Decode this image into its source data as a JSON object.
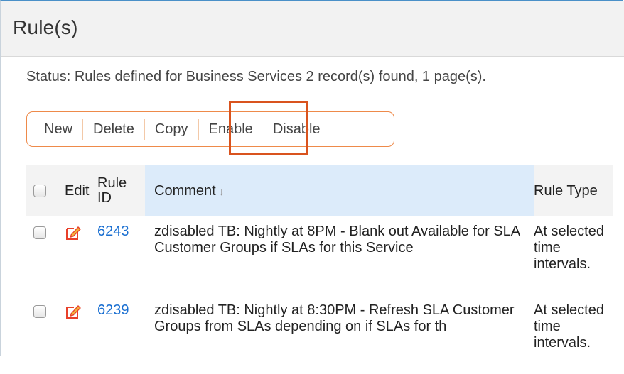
{
  "page": {
    "title": "Rule(s)"
  },
  "status": {
    "text": "Status: Rules defined for Business Services 2 record(s) found, 1 page(s)."
  },
  "toolbar": {
    "new_label": "New",
    "delete_label": "Delete",
    "copy_label": "Copy",
    "enable_label": "Enable",
    "disable_label": "Disable"
  },
  "table": {
    "headers": {
      "edit": "Edit",
      "rule_id_line1": "Rule",
      "rule_id_line2": "ID",
      "comment": "Comment",
      "comment_sort": "↓",
      "rule_type": "Rule Type"
    },
    "rows": [
      {
        "rule_id": "6243",
        "comment": "zdisabled TB: Nightly at 8PM - Blank out Available for SLA Customer Groups if SLAs for this Service",
        "rule_type": "At selected time intervals."
      },
      {
        "rule_id": "6239",
        "comment": "zdisabled TB: Nightly at 8:30PM - Refresh SLA Customer Groups from SLAs depending on if SLAs for th",
        "rule_type": "At selected time intervals."
      }
    ]
  },
  "colors": {
    "toolbar_border": "#ee8a4a",
    "highlight": "#d9531e",
    "link": "#1a6fd1",
    "sorted_header": "#dcebfa",
    "edit_icon": "#e8402a"
  }
}
